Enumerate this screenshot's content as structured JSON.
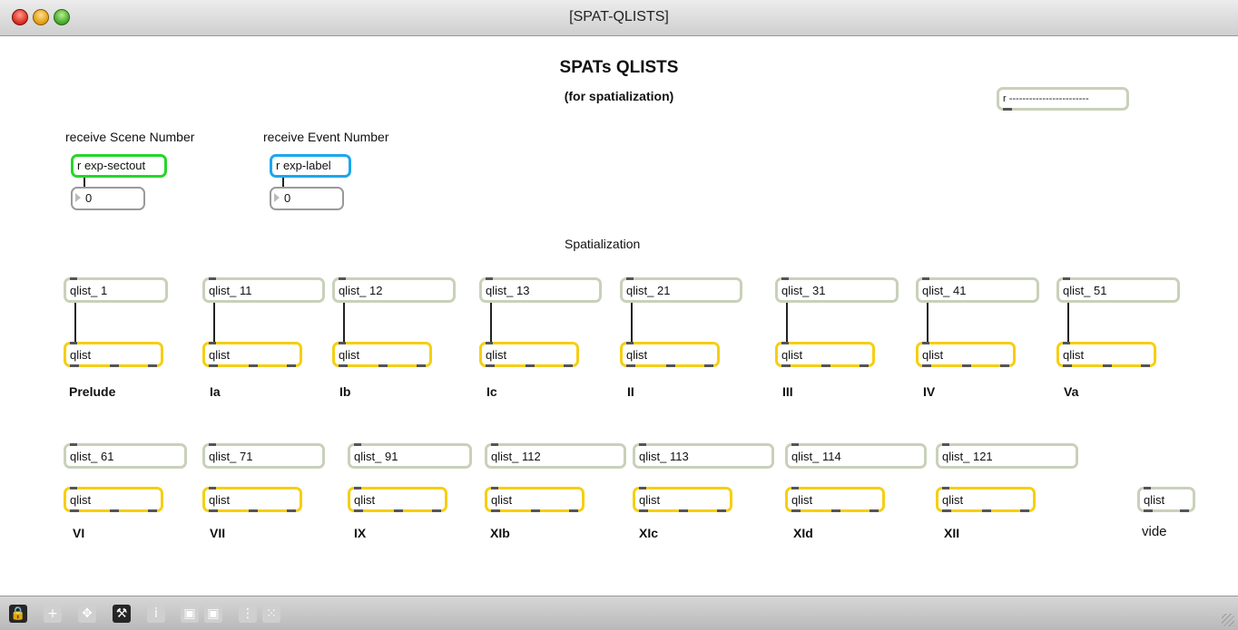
{
  "window": {
    "title": "[SPAT-QLISTS]"
  },
  "header": {
    "title": "SPATs  QLISTS",
    "subtitle": "(for spatialization)"
  },
  "receive_top_right": {
    "text": "r ------------------------"
  },
  "scene": {
    "label": "receive Scene Number",
    "receive": "r exp-sectout",
    "value": "0"
  },
  "event": {
    "label": "receive Event Number",
    "receive": "r exp-label",
    "value": "0"
  },
  "section_label": "Spatialization",
  "row1": [
    {
      "msg": "qlist_ 1",
      "obj": "qlist",
      "name": "Prelude"
    },
    {
      "msg": "qlist_ 11",
      "obj": "qlist",
      "name": "Ia"
    },
    {
      "msg": "qlist_ 12",
      "obj": "qlist",
      "name": "Ib"
    },
    {
      "msg": "qlist_ 13",
      "obj": "qlist",
      "name": "Ic"
    },
    {
      "msg": "qlist_ 21",
      "obj": "qlist",
      "name": "II"
    },
    {
      "msg": "qlist_ 31",
      "obj": "qlist",
      "name": "III"
    },
    {
      "msg": "qlist_ 41",
      "obj": "qlist",
      "name": "IV"
    },
    {
      "msg": "qlist_ 51",
      "obj": "qlist",
      "name": "Va"
    }
  ],
  "row2": [
    {
      "msg": "qlist_ 61",
      "obj": "qlist",
      "name": "VI"
    },
    {
      "msg": "qlist_ 71",
      "obj": "qlist",
      "name": "VII"
    },
    {
      "msg": "qlist_ 91",
      "obj": "qlist",
      "name": "IX"
    },
    {
      "msg": "qlist_ 112",
      "obj": "qlist",
      "name": "XIb"
    },
    {
      "msg": "qlist_ 113",
      "obj": "qlist",
      "name": "XIc"
    },
    {
      "msg": "qlist_ 114",
      "obj": "qlist",
      "name": "XId"
    },
    {
      "msg": "qlist_ 121",
      "obj": "qlist",
      "name": "XII"
    }
  ],
  "vide": {
    "obj": "qlist",
    "label": "vide"
  },
  "toolbar": [
    {
      "icon": "lock-icon",
      "glyph": "🔒"
    },
    {
      "icon": "add-icon",
      "glyph": "+"
    },
    {
      "icon": "move-icon",
      "glyph": "✥"
    },
    {
      "icon": "presentation-icon",
      "glyph": "⚒"
    },
    {
      "icon": "info-icon",
      "glyph": "i"
    },
    {
      "icon": "bring-front-icon",
      "glyph": "▣"
    },
    {
      "icon": "send-back-icon",
      "glyph": "▣"
    },
    {
      "icon": "grid-icon",
      "glyph": "⋮"
    },
    {
      "icon": "snap-grid-icon",
      "glyph": "⁙"
    }
  ]
}
